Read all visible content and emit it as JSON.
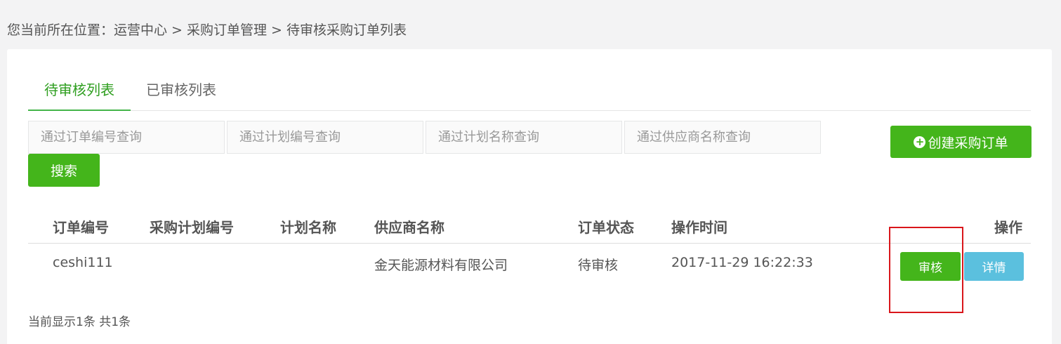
{
  "breadcrumb": "您当前所在位置：运营中心 > 采购订单管理 > 待审核采购订单列表",
  "tabs": [
    {
      "label": "待审核列表",
      "active": true
    },
    {
      "label": "已审核列表",
      "active": false
    }
  ],
  "search": {
    "order_no_placeholder": "通过订单编号查询",
    "plan_no_placeholder": "通过计划编号查询",
    "plan_name_placeholder": "通过计划名称查询",
    "supplier_placeholder": "通过供应商名称查询",
    "button": "搜索"
  },
  "create_button": {
    "label": "创建采购订单",
    "icon": "plus-circle-icon"
  },
  "table": {
    "headers": [
      "订单编号",
      "采购计划编号",
      "计划名称",
      "供应商名称",
      "订单状态",
      "操作时间",
      "操作"
    ],
    "rows": [
      {
        "order_no": "ceshi111",
        "plan_no": "",
        "plan_name": "",
        "supplier": "金天能源材料有限公司",
        "status": "待审核",
        "time": "2017-11-29 16:22:33",
        "actions": {
          "review": "审核",
          "detail": "详情"
        }
      }
    ]
  },
  "footer": {
    "count_text": "当前显示1条 共1条"
  },
  "colors": {
    "accent": "#44b51b",
    "info": "#5bc0de",
    "highlight": "#d9161b"
  }
}
